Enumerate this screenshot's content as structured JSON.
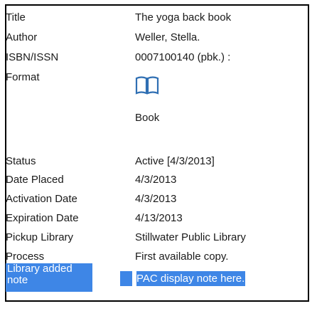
{
  "record": {
    "title_label": "Title",
    "title_value": "The yoga back book",
    "author_label": "Author",
    "author_value": "Weller, Stella.",
    "isbn_label": "ISBN/ISSN",
    "isbn_value": "0007100140 (pbk.) :",
    "format_label": "Format",
    "format_icon": "book-icon",
    "format_value": "Book",
    "status_label": "Status",
    "status_value": "Active [4/3/2013]",
    "date_placed_label": "Date Placed",
    "date_placed_value": "4/3/2013",
    "activation_label": "Activation Date",
    "activation_value": "4/3/2013",
    "expiration_label": "Expiration Date",
    "expiration_value": "4/13/2013",
    "pickup_label": "Pickup Library",
    "pickup_value": "Stillwater Public Library",
    "process_label": "Process",
    "process_value": "First available copy.",
    "note_label": "Library added note",
    "note_value": "PAC display note here."
  },
  "colors": {
    "selection": "#3e86e6",
    "border": "#000000"
  }
}
